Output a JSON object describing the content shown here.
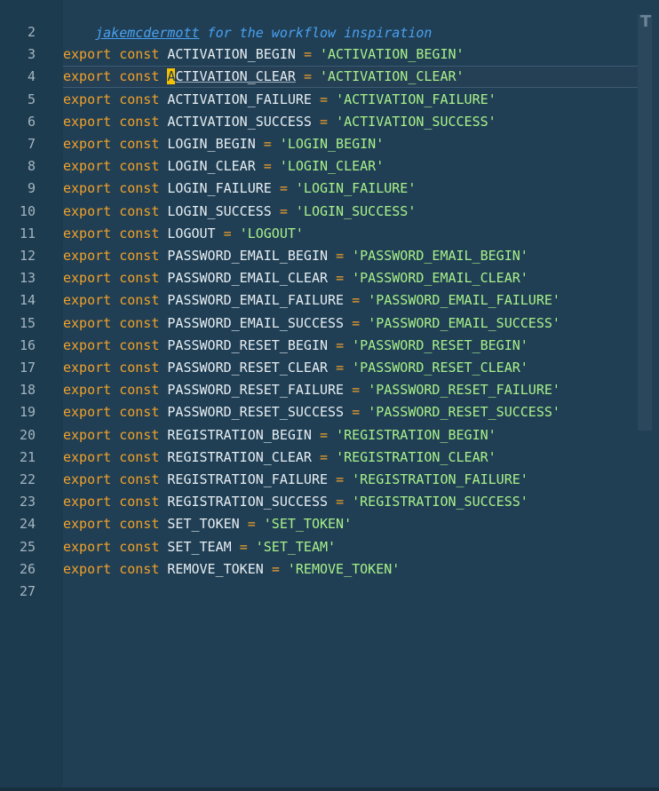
{
  "comment": {
    "author_link": "jakemcdermott",
    "rest": " for the workflow inspiration"
  },
  "keywords": {
    "export": "export",
    "const": "const",
    "equals": "="
  },
  "scrollbar_letter": "T",
  "lines": [
    {
      "num": "2",
      "name": "",
      "value": ""
    },
    {
      "num": "3",
      "name": "ACTIVATION_BEGIN",
      "value": "'ACTIVATION_BEGIN'"
    },
    {
      "num": "4",
      "name": "ACTIVATION_CLEAR",
      "value": "'ACTIVATION_CLEAR'"
    },
    {
      "num": "5",
      "name": "ACTIVATION_FAILURE",
      "value": "'ACTIVATION_FAILURE'"
    },
    {
      "num": "6",
      "name": "ACTIVATION_SUCCESS",
      "value": "'ACTIVATION_SUCCESS'"
    },
    {
      "num": "7",
      "name": "LOGIN_BEGIN",
      "value": "'LOGIN_BEGIN'"
    },
    {
      "num": "8",
      "name": "LOGIN_CLEAR",
      "value": "'LOGIN_CLEAR'"
    },
    {
      "num": "9",
      "name": "LOGIN_FAILURE",
      "value": "'LOGIN_FAILURE'"
    },
    {
      "num": "10",
      "name": "LOGIN_SUCCESS",
      "value": "'LOGIN_SUCCESS'"
    },
    {
      "num": "11",
      "name": "LOGOUT",
      "value": "'LOGOUT'"
    },
    {
      "num": "12",
      "name": "PASSWORD_EMAIL_BEGIN",
      "value": "'PASSWORD_EMAIL_BEGIN'"
    },
    {
      "num": "13",
      "name": "PASSWORD_EMAIL_CLEAR",
      "value": "'PASSWORD_EMAIL_CLEAR'"
    },
    {
      "num": "14",
      "name": "PASSWORD_EMAIL_FAILURE",
      "value": "'PASSWORD_EMAIL_FAILURE'"
    },
    {
      "num": "15",
      "name": "PASSWORD_EMAIL_SUCCESS",
      "value": "'PASSWORD_EMAIL_SUCCESS'"
    },
    {
      "num": "16",
      "name": "PASSWORD_RESET_BEGIN",
      "value": "'PASSWORD_RESET_BEGIN'"
    },
    {
      "num": "17",
      "name": "PASSWORD_RESET_CLEAR",
      "value": "'PASSWORD_RESET_CLEAR'"
    },
    {
      "num": "18",
      "name": "PASSWORD_RESET_FAILURE",
      "value": "'PASSWORD_RESET_FAILURE'"
    },
    {
      "num": "19",
      "name": "PASSWORD_RESET_SUCCESS",
      "value": "'PASSWORD_RESET_SUCCESS'"
    },
    {
      "num": "20",
      "name": "REGISTRATION_BEGIN",
      "value": "'REGISTRATION_BEGIN'"
    },
    {
      "num": "21",
      "name": "REGISTRATION_CLEAR",
      "value": "'REGISTRATION_CLEAR'"
    },
    {
      "num": "22",
      "name": "REGISTRATION_FAILURE",
      "value": "'REGISTRATION_FAILURE'"
    },
    {
      "num": "23",
      "name": "REGISTRATION_SUCCESS",
      "value": "'REGISTRATION_SUCCESS'"
    },
    {
      "num": "24",
      "name": "SET_TOKEN",
      "value": "'SET_TOKEN'"
    },
    {
      "num": "25",
      "name": "SET_TEAM",
      "value": "'SET_TEAM'"
    },
    {
      "num": "26",
      "name": "REMOVE_TOKEN",
      "value": "'REMOVE_TOKEN'"
    },
    {
      "num": "27",
      "name": "",
      "value": ""
    }
  ],
  "cursor_line_index": 2,
  "colors": {
    "background": "#1d3b4f",
    "keyword": "#f0a02a",
    "string": "#a8f08a",
    "identifier": "#e6edf2",
    "comment": "#4aa0f0",
    "cursor": "#f5c000"
  }
}
